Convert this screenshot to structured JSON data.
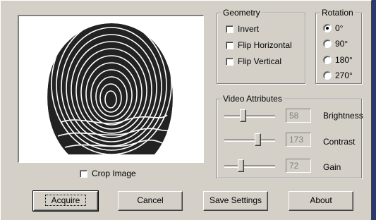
{
  "geometry": {
    "title": "Geometry",
    "options": [
      {
        "label": "Invert",
        "checked": false
      },
      {
        "label": "Flip Horizontal",
        "checked": false
      },
      {
        "label": "Flip Vertical",
        "checked": false
      }
    ]
  },
  "rotation": {
    "title": "Rotation",
    "options": [
      {
        "label": "0°",
        "selected": true
      },
      {
        "label": "90°",
        "selected": false
      },
      {
        "label": "180°",
        "selected": false
      },
      {
        "label": "270°",
        "selected": false
      }
    ]
  },
  "video": {
    "title": "Video Attributes",
    "sliders": [
      {
        "label": "Brightness",
        "value": "58",
        "level": 0.35
      },
      {
        "label": "Contrast",
        "value": "173",
        "level": 0.68
      },
      {
        "label": "Gain",
        "value": "72",
        "level": 0.3
      }
    ]
  },
  "preview": {
    "icon": "fingerprint-image"
  },
  "crop": {
    "label": "Crop Image",
    "checked": false
  },
  "buttons": {
    "acquire": "Acquire",
    "cancel": "Cancel",
    "save": "Save Settings",
    "about": "About"
  }
}
